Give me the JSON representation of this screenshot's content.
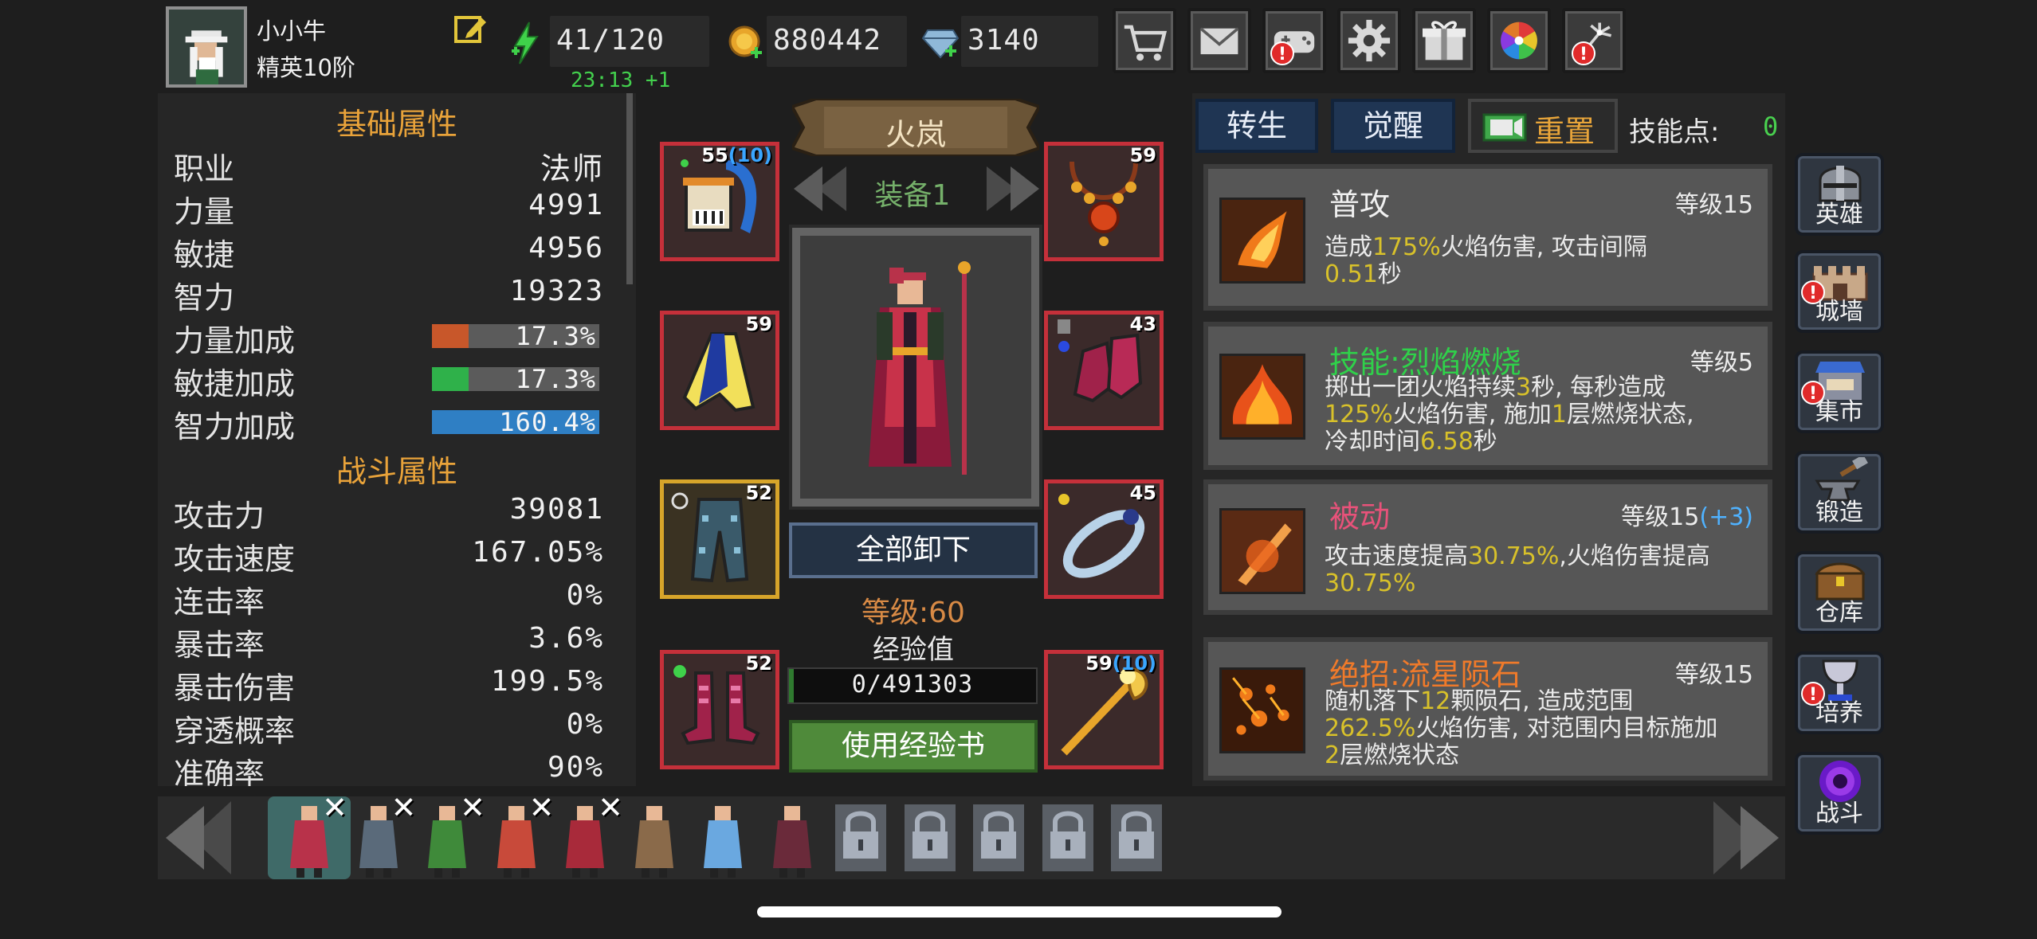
{
  "player": {
    "name": "小小牛",
    "rank": "精英10阶"
  },
  "resources": {
    "stamina": "41/120",
    "regen_timer": "23:13 +1",
    "gold": "880442",
    "gems": "3140"
  },
  "top_buttons": [
    {
      "icon": "shop-cart-icon",
      "alert": ""
    },
    {
      "icon": "mail-icon",
      "alert": ""
    },
    {
      "icon": "gamepad-icon",
      "alert": "!"
    },
    {
      "icon": "settings-gear-icon",
      "alert": ""
    },
    {
      "icon": "gift-icon",
      "alert": ""
    },
    {
      "icon": "color-wheel-icon",
      "alert": ""
    },
    {
      "icon": "fireworks-icon",
      "alert": "!"
    }
  ],
  "stats": {
    "basic_title": "基础属性",
    "basic": [
      {
        "label": "职业",
        "value": "法师"
      },
      {
        "label": "力量",
        "value": "4991"
      },
      {
        "label": "敏捷",
        "value": "4956"
      },
      {
        "label": "智力",
        "value": "19323"
      }
    ],
    "bonus": [
      {
        "label": "力量加成",
        "value": "17.3%",
        "percent": 17.3,
        "color": "#c8572a"
      },
      {
        "label": "敏捷加成",
        "value": "17.3%",
        "percent": 17.3,
        "color": "#2fb14a"
      },
      {
        "label": "智力加成",
        "value": "160.4%",
        "percent": 100,
        "color": "#2f7fc4"
      }
    ],
    "combat_title": "战斗属性",
    "combat": [
      {
        "label": "攻击力",
        "value": "39081"
      },
      {
        "label": "攻击速度",
        "value": "167.05%"
      },
      {
        "label": "连击率",
        "value": "0%"
      },
      {
        "label": "暴击率",
        "value": "3.6%"
      },
      {
        "label": "暴击伤害",
        "value": "199.5%"
      },
      {
        "label": "穿透概率",
        "value": "0%"
      },
      {
        "label": "准确率",
        "value": "90%"
      }
    ]
  },
  "equipment": {
    "hero_name": "火岚",
    "set_name": "装备1",
    "unequip_all": "全部卸下",
    "level": "等级:60",
    "exp_label": "经验值",
    "exp_value": "0/491303",
    "exp_fraction": 0,
    "use_exp_book": "使用经验书",
    "slots": [
      {
        "name": "helmet",
        "level": "55",
        "bonus": "(10)"
      },
      {
        "name": "necklace",
        "level": "59",
        "bonus": ""
      },
      {
        "name": "cloak",
        "level": "59",
        "bonus": ""
      },
      {
        "name": "gloves",
        "level": "43",
        "bonus": ""
      },
      {
        "name": "pants",
        "level": "52",
        "bonus": ""
      },
      {
        "name": "ring",
        "level": "45",
        "bonus": ""
      },
      {
        "name": "boots",
        "level": "52",
        "bonus": ""
      },
      {
        "name": "staff",
        "level": "59",
        "bonus": "(10)"
      }
    ]
  },
  "skills_panel": {
    "tab_rebirth": "转生",
    "tab_awaken": "觉醒",
    "reset": "重置",
    "skill_points_label": "技能点:",
    "skill_points": "0",
    "skills": [
      {
        "name": "普攻",
        "name_color": "#f0f0f0",
        "level": "等级15",
        "level_extra": "",
        "desc": [
          [
            "造成",
            ""
          ],
          [
            "175%",
            "y"
          ],
          [
            "火焰伤害, 攻击间隔",
            ""
          ],
          [
            "\n",
            ""
          ],
          [
            "0.51",
            "y"
          ],
          [
            "秒",
            ""
          ]
        ]
      },
      {
        "name": "技能:烈焰燃烧",
        "name_color": "#2fd14a",
        "level": "等级5",
        "level_extra": "",
        "desc": [
          [
            "掷出一团火焰持续",
            ""
          ],
          [
            "3",
            "y"
          ],
          [
            "秒, 每秒造成",
            ""
          ],
          [
            "\n",
            ""
          ],
          [
            "125%",
            "y"
          ],
          [
            "火焰伤害, 施加",
            ""
          ],
          [
            "1",
            "y"
          ],
          [
            "层燃烧状态,",
            ""
          ],
          [
            "\n",
            ""
          ],
          [
            "冷却时间",
            ""
          ],
          [
            "6.58",
            "y"
          ],
          [
            "秒",
            ""
          ]
        ]
      },
      {
        "name": "被动",
        "name_color": "#e8527a",
        "level": "等级15",
        "level_extra": "(+3)",
        "desc": [
          [
            "攻击速度提高",
            ""
          ],
          [
            "30.75%",
            "y"
          ],
          [
            ",火焰伤害提高",
            ""
          ],
          [
            "\n",
            ""
          ],
          [
            "30.75%",
            "y"
          ]
        ]
      },
      {
        "name": "绝招:流星陨石",
        "name_color": "#f07a2a",
        "level": "等级15",
        "level_extra": "",
        "desc": [
          [
            "随机落下",
            ""
          ],
          [
            "12",
            "y"
          ],
          [
            "颗陨石, 造成范围",
            ""
          ],
          [
            "\n",
            ""
          ],
          [
            "262.5%",
            "y"
          ],
          [
            "火焰伤害, 对范围内目标施加",
            ""
          ],
          [
            "\n",
            ""
          ],
          [
            "2",
            "y"
          ],
          [
            "层燃烧状态",
            ""
          ]
        ]
      }
    ]
  },
  "side_nav": [
    {
      "label": "英雄",
      "icon": "hero-helmet-icon",
      "alert": false
    },
    {
      "label": "城墙",
      "icon": "castle-wall-icon",
      "alert": true
    },
    {
      "label": "集市",
      "icon": "market-stall-icon",
      "alert": true
    },
    {
      "label": "锻造",
      "icon": "anvil-hammer-icon",
      "alert": false
    },
    {
      "label": "仓库",
      "icon": "warehouse-chest-icon",
      "alert": false
    },
    {
      "label": "培养",
      "icon": "grail-cup-icon",
      "alert": true
    },
    {
      "label": "战斗",
      "icon": "portal-icon",
      "alert": false
    }
  ],
  "hero_roster": [
    {
      "id": "fire-mage",
      "locked": false,
      "selected": true,
      "x": true,
      "color": "#b8324a"
    },
    {
      "id": "swordsman",
      "locked": false,
      "selected": false,
      "x": true,
      "color": "#5a6a7a"
    },
    {
      "id": "elf-archer",
      "locked": false,
      "selected": false,
      "x": true,
      "color": "#3f8a3a"
    },
    {
      "id": "dwarf-gunner",
      "locked": false,
      "selected": false,
      "x": true,
      "color": "#c84a3a"
    },
    {
      "id": "vampire",
      "locked": false,
      "selected": false,
      "x": true,
      "color": "#a82a3a"
    },
    {
      "id": "amazon",
      "locked": false,
      "selected": false,
      "x": false,
      "color": "#8a6a4a"
    },
    {
      "id": "ice-mage",
      "locked": false,
      "selected": false,
      "x": false,
      "color": "#6aa8e0"
    },
    {
      "id": "dark-knight",
      "locked": false,
      "selected": false,
      "x": false,
      "color": "#6a2a3a"
    },
    {
      "id": "locked-1",
      "locked": true,
      "selected": false,
      "x": false,
      "color": "#777"
    },
    {
      "id": "locked-2",
      "locked": true,
      "selected": false,
      "x": false,
      "color": "#777"
    },
    {
      "id": "locked-3",
      "locked": true,
      "selected": false,
      "x": false,
      "color": "#777"
    },
    {
      "id": "locked-4",
      "locked": true,
      "selected": false,
      "x": false,
      "color": "#777"
    },
    {
      "id": "locked-5",
      "locked": true,
      "selected": false,
      "x": false,
      "color": "#777"
    }
  ]
}
